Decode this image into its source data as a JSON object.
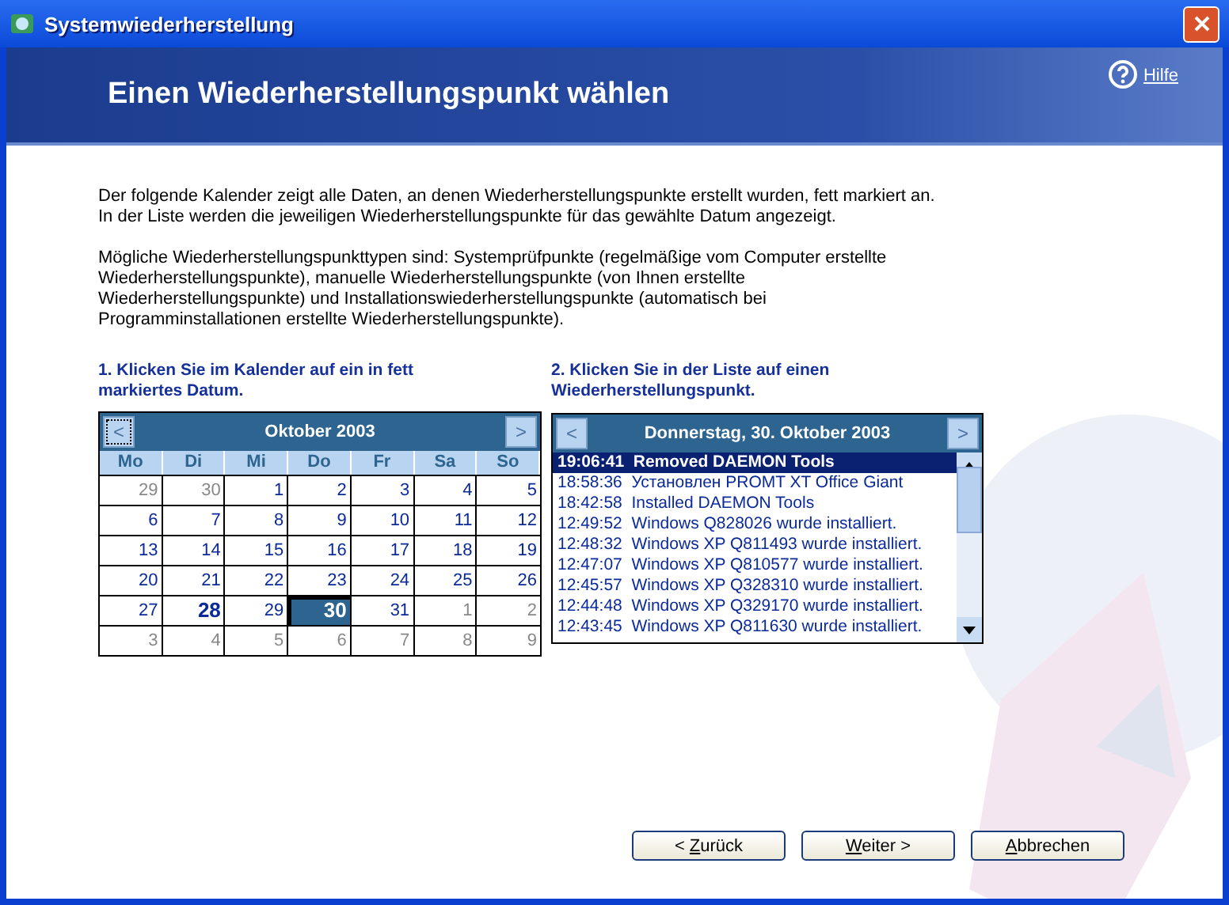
{
  "window": {
    "title": "Systemwiederherstellung"
  },
  "header": {
    "title": "Einen Wiederherstellungspunkt wählen",
    "help": "Hilfe"
  },
  "intro": [
    "Der folgende Kalender zeigt alle Daten, an denen Wiederherstellungspunkte erstellt wurden, fett markiert an. In der Liste werden die jeweiligen Wiederherstellungspunkte für das gewählte Datum angezeigt.",
    "Mögliche Wiederherstellungspunkttypen sind: Systemprüfpunkte (regelmäßige vom Computer erstellte Wiederherstellungspunkte), manuelle Wiederherstellungspunkte (von Ihnen erstellte Wiederherstellungspunkte) und Installationswiederherstellungspunkte (automatisch bei Programminstallationen erstellte Wiederherstellungspunkte)."
  ],
  "calendar": {
    "step": "1. Klicken Sie im Kalender auf ein in fett markiertes Datum.",
    "prev": "<",
    "next": ">",
    "month": "Oktober 2003",
    "weekdays": [
      "Mo",
      "Di",
      "Mi",
      "Do",
      "Fr",
      "Sa",
      "So"
    ],
    "weeks": [
      [
        {
          "day": "29",
          "other_month": true,
          "bold": false,
          "selected": false
        },
        {
          "day": "30",
          "other_month": true,
          "bold": false,
          "selected": false
        },
        {
          "day": "1",
          "other_month": false,
          "bold": false,
          "selected": false
        },
        {
          "day": "2",
          "other_month": false,
          "bold": false,
          "selected": false
        },
        {
          "day": "3",
          "other_month": false,
          "bold": false,
          "selected": false
        },
        {
          "day": "4",
          "other_month": false,
          "bold": false,
          "selected": false
        },
        {
          "day": "5",
          "other_month": false,
          "bold": false,
          "selected": false
        }
      ],
      [
        {
          "day": "6",
          "other_month": false,
          "bold": false,
          "selected": false
        },
        {
          "day": "7",
          "other_month": false,
          "bold": false,
          "selected": false
        },
        {
          "day": "8",
          "other_month": false,
          "bold": false,
          "selected": false
        },
        {
          "day": "9",
          "other_month": false,
          "bold": false,
          "selected": false
        },
        {
          "day": "10",
          "other_month": false,
          "bold": false,
          "selected": false
        },
        {
          "day": "11",
          "other_month": false,
          "bold": false,
          "selected": false
        },
        {
          "day": "12",
          "other_month": false,
          "bold": false,
          "selected": false
        }
      ],
      [
        {
          "day": "13",
          "other_month": false,
          "bold": false,
          "selected": false
        },
        {
          "day": "14",
          "other_month": false,
          "bold": false,
          "selected": false
        },
        {
          "day": "15",
          "other_month": false,
          "bold": false,
          "selected": false
        },
        {
          "day": "16",
          "other_month": false,
          "bold": false,
          "selected": false
        },
        {
          "day": "17",
          "other_month": false,
          "bold": false,
          "selected": false
        },
        {
          "day": "18",
          "other_month": false,
          "bold": false,
          "selected": false
        },
        {
          "day": "19",
          "other_month": false,
          "bold": false,
          "selected": false
        }
      ],
      [
        {
          "day": "20",
          "other_month": false,
          "bold": false,
          "selected": false
        },
        {
          "day": "21",
          "other_month": false,
          "bold": false,
          "selected": false
        },
        {
          "day": "22",
          "other_month": false,
          "bold": false,
          "selected": false
        },
        {
          "day": "23",
          "other_month": false,
          "bold": false,
          "selected": false
        },
        {
          "day": "24",
          "other_month": false,
          "bold": false,
          "selected": false
        },
        {
          "day": "25",
          "other_month": false,
          "bold": false,
          "selected": false
        },
        {
          "day": "26",
          "other_month": false,
          "bold": false,
          "selected": false
        }
      ],
      [
        {
          "day": "27",
          "other_month": false,
          "bold": false,
          "selected": false
        },
        {
          "day": "28",
          "other_month": false,
          "bold": true,
          "selected": false
        },
        {
          "day": "29",
          "other_month": false,
          "bold": false,
          "selected": false
        },
        {
          "day": "30",
          "other_month": false,
          "bold": true,
          "selected": true
        },
        {
          "day": "31",
          "other_month": false,
          "bold": false,
          "selected": false
        },
        {
          "day": "1",
          "other_month": true,
          "bold": false,
          "selected": false
        },
        {
          "day": "2",
          "other_month": true,
          "bold": false,
          "selected": false
        }
      ],
      [
        {
          "day": "3",
          "other_month": true,
          "bold": false,
          "selected": false
        },
        {
          "day": "4",
          "other_month": true,
          "bold": false,
          "selected": false
        },
        {
          "day": "5",
          "other_month": true,
          "bold": false,
          "selected": false
        },
        {
          "day": "6",
          "other_month": true,
          "bold": false,
          "selected": false
        },
        {
          "day": "7",
          "other_month": true,
          "bold": false,
          "selected": false
        },
        {
          "day": "8",
          "other_month": true,
          "bold": false,
          "selected": false
        },
        {
          "day": "9",
          "other_month": true,
          "bold": false,
          "selected": false
        }
      ]
    ]
  },
  "restore_points": {
    "step": "2. Klicken Sie in der Liste auf einen Wiederherstellungspunkt.",
    "prev": "<",
    "next": ">",
    "date": "Donnerstag, 30. Oktober 2003",
    "items": [
      {
        "time": "19:06:41",
        "text": "Removed DAEMON Tools",
        "selected": true
      },
      {
        "time": "18:58:36",
        "text": "Установлен PROMT XT Office Giant",
        "selected": false
      },
      {
        "time": "18:42:58",
        "text": "Installed DAEMON Tools",
        "selected": false
      },
      {
        "time": "12:49:52",
        "text": "Windows Q828026 wurde installiert.",
        "selected": false
      },
      {
        "time": "12:48:32",
        "text": "Windows XP Q811493 wurde installiert.",
        "selected": false
      },
      {
        "time": "12:47:07",
        "text": "Windows XP Q810577 wurde installiert.",
        "selected": false
      },
      {
        "time": "12:45:57",
        "text": "Windows XP Q328310 wurde installiert.",
        "selected": false
      },
      {
        "time": "12:44:48",
        "text": "Windows XP Q329170 wurde installiert.",
        "selected": false
      },
      {
        "time": "12:43:45",
        "text": "Windows XP Q811630 wurde installiert.",
        "selected": false
      }
    ]
  },
  "buttons": [
    {
      "before": "< ",
      "key": "Z",
      "after": "urück"
    },
    {
      "key": "W",
      "after": "eiter >"
    },
    {
      "key": "A",
      "after": "bbrechen"
    }
  ]
}
